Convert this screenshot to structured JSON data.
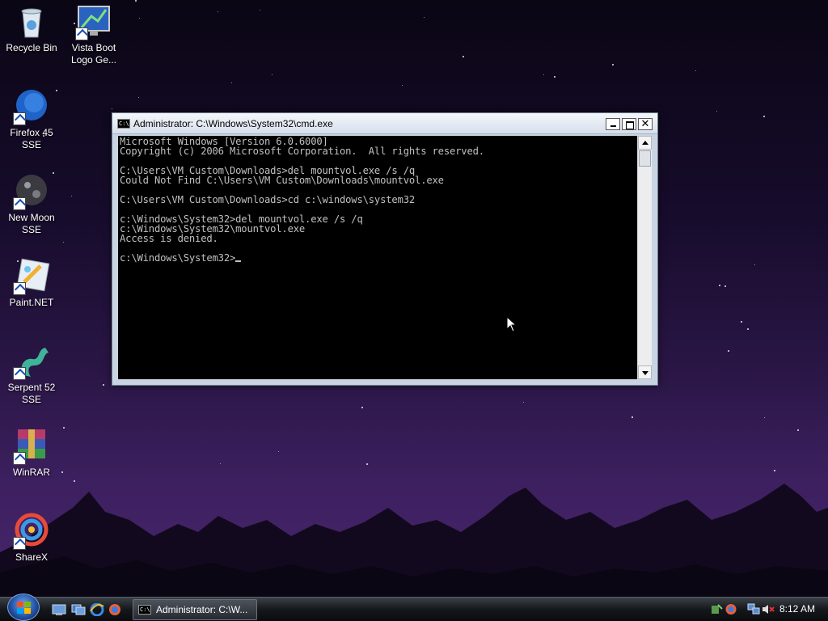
{
  "desktop": {
    "icons": [
      {
        "label": "Recycle Bin",
        "icon": "recycle-bin-icon"
      },
      {
        "label": "Vista Boot\nLogo Ge...",
        "icon": "vista-boot-logo-icon"
      },
      {
        "label": "Firefox 45 SSE",
        "icon": "firefox-icon"
      },
      {
        "label": "New Moon\nSSE",
        "icon": "new-moon-icon"
      },
      {
        "label": "Paint.NET",
        "icon": "paint-net-icon"
      },
      {
        "label": "Serpent 52\nSSE",
        "icon": "serpent-icon"
      },
      {
        "label": "WinRAR",
        "icon": "winrar-icon"
      },
      {
        "label": "ShareX",
        "icon": "sharex-icon"
      }
    ]
  },
  "cmd": {
    "title": "Administrator: C:\\Windows\\System32\\cmd.exe",
    "icon_text": "C:\\",
    "lines": [
      "Microsoft Windows [Version 6.0.6000]",
      "Copyright (c) 2006 Microsoft Corporation.  All rights reserved.",
      "",
      "C:\\Users\\VM Custom\\Downloads>del mountvol.exe /s /q",
      "Could Not Find C:\\Users\\VM Custom\\Downloads\\mountvol.exe",
      "",
      "C:\\Users\\VM Custom\\Downloads>cd c:\\windows\\system32",
      "",
      "c:\\Windows\\System32>del mountvol.exe /s /q",
      "c:\\Windows\\System32\\mountvol.exe",
      "Access is denied.",
      ""
    ],
    "prompt": "c:\\Windows\\System32>",
    "close_glyph": "✕"
  },
  "taskbar": {
    "task_label": "Administrator: C:\\W...",
    "task_icon_text": "C:\\",
    "clock": "8:12 AM"
  },
  "colors": {
    "console_bg": "#000000",
    "console_fg": "#c0c0c0",
    "window_frame": "#c9d4e3"
  }
}
